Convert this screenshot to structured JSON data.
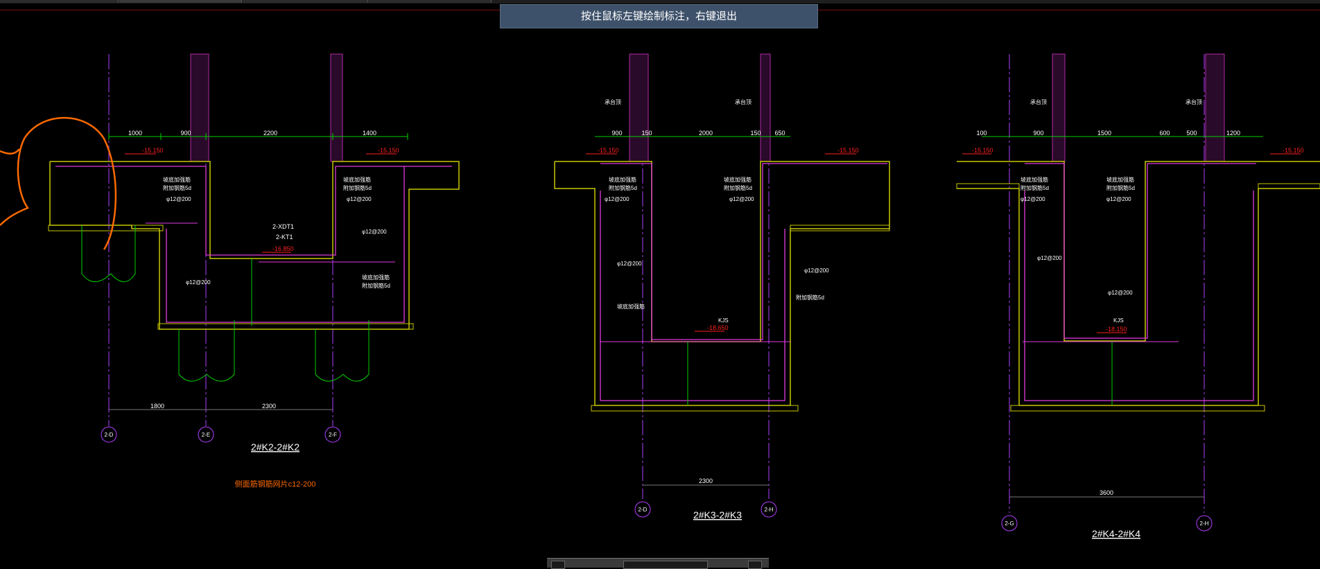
{
  "tooltip": {
    "text": "按住鼠标左键绘制标注，右键退出"
  },
  "colors": {
    "background": "#000000",
    "wall_fill": "#b02aa8",
    "slab_outline": "#c8c800",
    "rebar": "#e23ae0",
    "dimension": "#00d000",
    "axis": "#b040ff",
    "elevation": "#ff2020",
    "annotation_stroke": "#ff6a00",
    "tooltip_bg": "#3e516a"
  },
  "sections": [
    {
      "title": "2#K2-2#K2",
      "note": "侧面筋钢筋网片c12-200",
      "top_dims": [
        "1000",
        "900",
        "2200",
        "1400"
      ],
      "bottom_dims": [
        "1800",
        "2300"
      ],
      "axes": [
        "2-D",
        "2-E",
        "2-F"
      ],
      "elevations": [
        "-15.150",
        "-15.150",
        "-16.850"
      ],
      "labels": [
        "2-XDT1",
        "2-KT1"
      ],
      "rebar_labels": [
        "φ12@200",
        "φ12@200",
        "φ12@200",
        "φ12@200"
      ],
      "note_labels": [
        "坡底加强筋",
        "附加钢筋5d",
        "坡底加强筋",
        "附加钢筋5d",
        "坡底加强筋",
        "附加钢筋5d"
      ]
    },
    {
      "title": "2#K3-2#K3",
      "top_dims": [
        "900",
        "150",
        "2000",
        "150",
        "650"
      ],
      "bottom_dims": [
        "2300"
      ],
      "axes": [
        "2-D",
        "2-H"
      ],
      "elevations": [
        "-15.150",
        "-15.150",
        "-18.650"
      ],
      "labels": [
        "KJS"
      ],
      "rebar_labels": [
        "φ12@200",
        "φ12@200",
        "φ12@200",
        "φ12@200"
      ],
      "note_labels": [
        "坡底加强筋",
        "附加钢筋5d",
        "坡底加强筋",
        "附加钢筋5d",
        "坡底加强筋",
        "附加钢筋5d"
      ],
      "side_labels": [
        "承台顶",
        "承台顶"
      ]
    },
    {
      "title": "2#K4-2#K4",
      "top_dims": [
        "100",
        "900",
        "1500",
        "600",
        "500",
        "1200"
      ],
      "bottom_dims": [
        "3600"
      ],
      "axes": [
        "2-G",
        "2-H"
      ],
      "elevations": [
        "-15.150",
        "-15.150",
        "-18.150"
      ],
      "labels": [
        "KJS"
      ],
      "rebar_labels": [
        "φ12@200",
        "φ12@200",
        "φ12@200",
        "φ12@200"
      ],
      "note_labels": [
        "坡底加强筋",
        "附加钢筋5d",
        "坡底加强筋",
        "附加钢筋5d"
      ],
      "side_labels": [
        "承台顶",
        "承台顶"
      ]
    }
  ]
}
